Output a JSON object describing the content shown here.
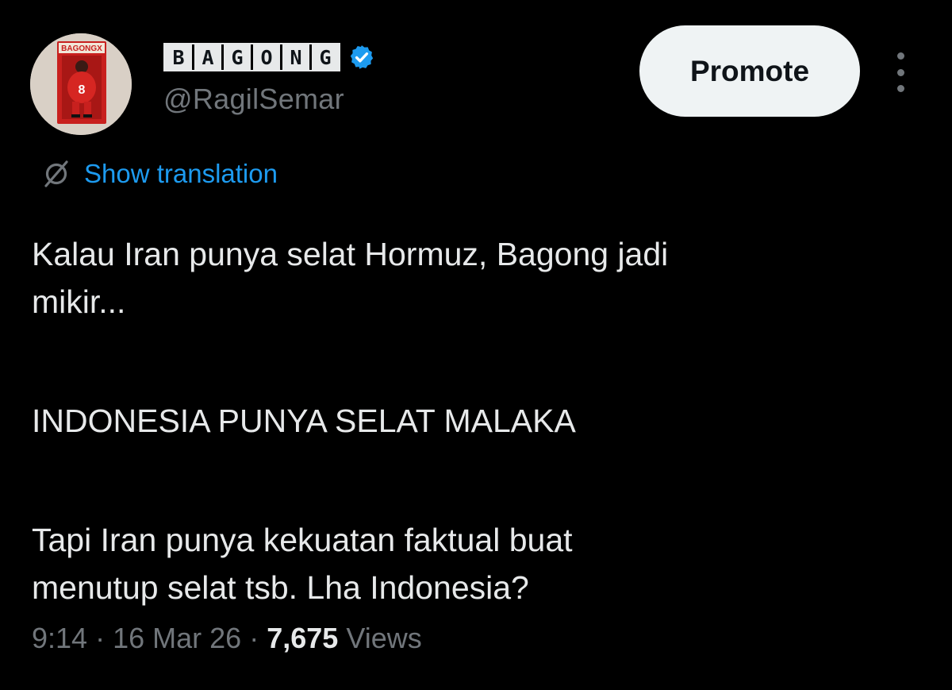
{
  "author": {
    "display_name_letters": [
      "B",
      "A",
      "G",
      "O",
      "N",
      "G"
    ],
    "handle": "@RagilSemar",
    "verified": true,
    "verified_color": "#1d9bf0",
    "avatar_text": "BAGONGX",
    "avatar_jersey_number": "8"
  },
  "header": {
    "promote_label": "Promote",
    "more_icon": "more-vertical-icon"
  },
  "translation": {
    "icon": "translate-icon",
    "label": "Show translation",
    "color": "#1d9bf0"
  },
  "tweet": {
    "paragraphs": [
      [
        "Kalau Iran punya selat Hormuz, Bagong jadi",
        "mikir..."
      ],
      [
        "INDONESIA PUNYA SELAT MALAKA"
      ],
      [
        "Tapi Iran punya kekuatan faktual buat",
        "menutup selat tsb. Lha Indonesia?"
      ]
    ]
  },
  "meta": {
    "time": "9:14",
    "date": "16 Mar 26",
    "separator": "·",
    "views_count": "7,675",
    "views_label": "Views"
  },
  "colors": {
    "background": "#000000",
    "text": "#e7e9ea",
    "muted": "#71767b",
    "button_bg": "#eff3f4"
  }
}
